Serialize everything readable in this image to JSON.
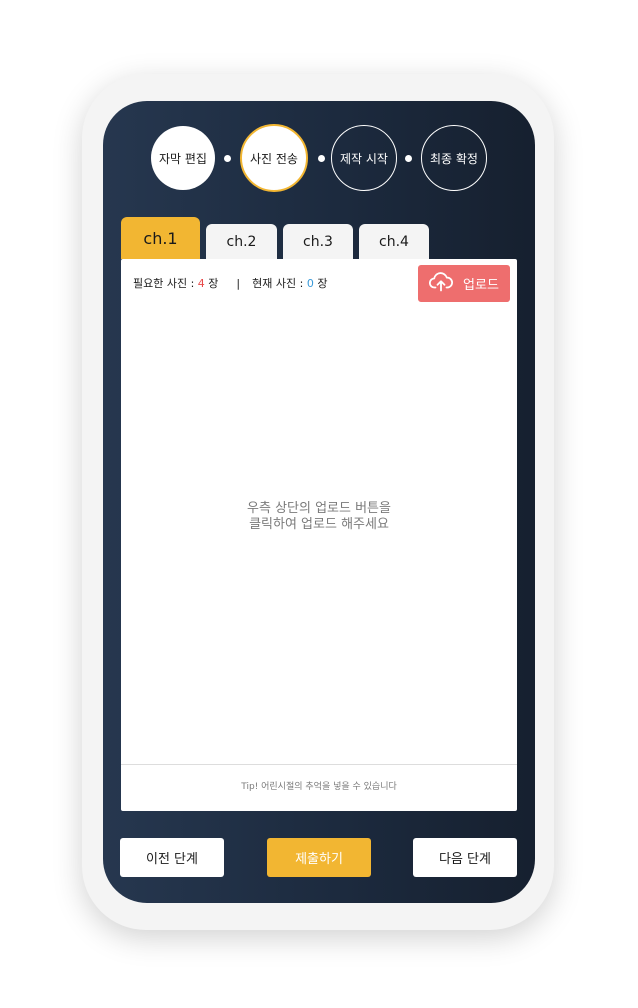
{
  "steps": [
    {
      "label": "자막 편집"
    },
    {
      "label": "사진 전송"
    },
    {
      "label": "제작 시작"
    },
    {
      "label": "최종 확정"
    }
  ],
  "tabs": [
    {
      "label": "ch.1"
    },
    {
      "label": "ch.2"
    },
    {
      "label": "ch.3"
    },
    {
      "label": "ch.4"
    }
  ],
  "panel": {
    "required_label": "필요한 사진 : ",
    "required_count": "4",
    "unit": " 장",
    "separator": "|",
    "current_label": "현재 사진 : ",
    "current_count": "0",
    "upload_label": "업로드",
    "empty_line1": "우측 상단의 업로드 버튼을",
    "empty_line2": "클릭하여 업로드 해주세요",
    "tip": "Tip!  어린시절의 추억을 넣을 수 있습니다"
  },
  "buttons": {
    "prev": "이전 단계",
    "submit": "제출하기",
    "next": "다음 단계"
  },
  "colors": {
    "accent": "#f2b632",
    "upload": "#ee6e6e",
    "background": "#1c2a3e"
  }
}
